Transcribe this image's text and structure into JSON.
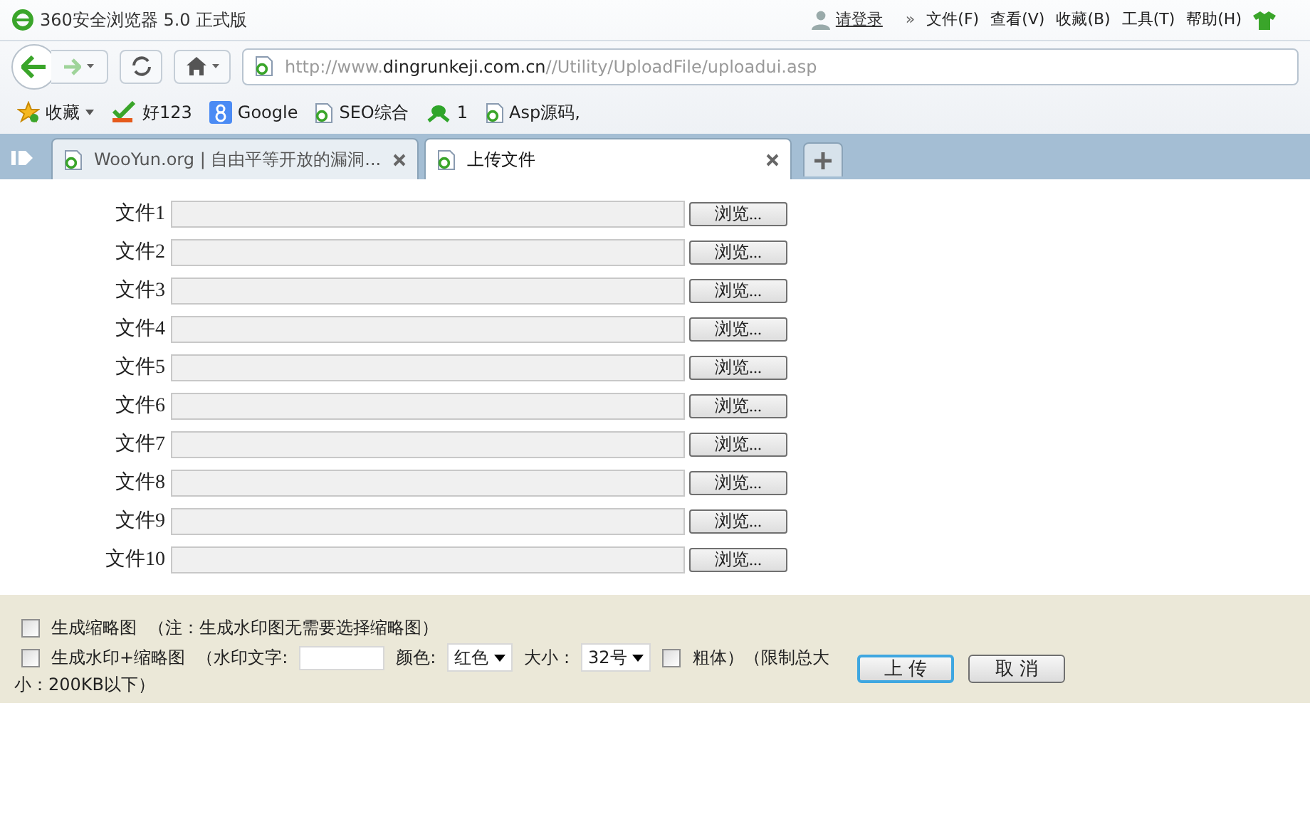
{
  "window": {
    "title": "360安全浏览器 5.0 正式版"
  },
  "menu": {
    "login": "请登录",
    "more": "»",
    "items": [
      "文件(F)",
      "查看(V)",
      "收藏(B)",
      "工具(T)",
      "帮助(H)"
    ]
  },
  "address": {
    "prefix": "http://www.",
    "domain": "dingrunkeji.com.cn",
    "path": "//Utility/UploadFile/uploadui.asp"
  },
  "bookmarks": [
    {
      "label": "收藏",
      "kind": "star"
    },
    {
      "label": "好123",
      "kind": "hao"
    },
    {
      "label": "Google",
      "kind": "google"
    },
    {
      "label": "SEO综合",
      "kind": "page"
    },
    {
      "label": "1",
      "kind": "frog"
    },
    {
      "label": "Asp源码,",
      "kind": "page"
    }
  ],
  "tabs": [
    {
      "label": "WooYun.org | 自由平等开放的漏洞...",
      "selected": false
    },
    {
      "label": "上传文件",
      "selected": true
    }
  ],
  "files": [
    {
      "label": "文件1",
      "button": "浏览..."
    },
    {
      "label": "文件2",
      "button": "浏览..."
    },
    {
      "label": "文件3",
      "button": "浏览..."
    },
    {
      "label": "文件4",
      "button": "浏览..."
    },
    {
      "label": "文件5",
      "button": "浏览..."
    },
    {
      "label": "文件6",
      "button": "浏览..."
    },
    {
      "label": "文件7",
      "button": "浏览..."
    },
    {
      "label": "文件8",
      "button": "浏览..."
    },
    {
      "label": "文件9",
      "button": "浏览..."
    },
    {
      "label": "文件10",
      "button": "浏览..."
    }
  ],
  "options": {
    "thumbnail": {
      "label": "生成缩略图",
      "note": "（注：生成水印图无需要选择缩略图）",
      "checked": false
    },
    "watermark": {
      "label": "生成水印+缩略图",
      "text_label": "（水印文字:",
      "color_label": "颜色:",
      "color_value": "红色",
      "size_label": "大小 :",
      "size_value": "32号",
      "checked": false
    },
    "bold": {
      "label": "粗体）（限制总大",
      "continued": "小：200KB以下）",
      "checked": false
    }
  },
  "buttons": [
    {
      "label": "上 传",
      "kind": "primary"
    },
    {
      "label": "取 消",
      "kind": "normal"
    }
  ]
}
